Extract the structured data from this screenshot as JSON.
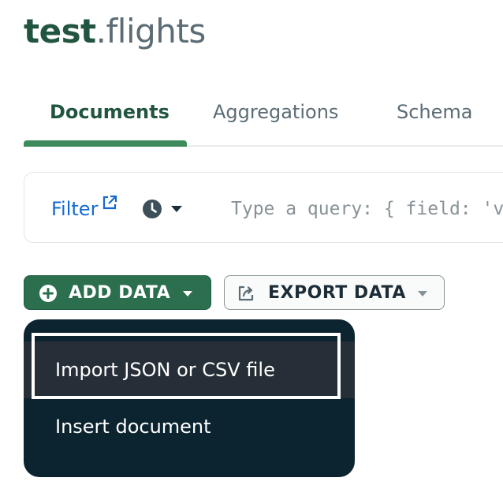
{
  "header": {
    "db": "test",
    "dot": ".",
    "collection": "flights"
  },
  "tabs": [
    {
      "label": "Documents",
      "active": true
    },
    {
      "label": "Aggregations",
      "active": false
    },
    {
      "label": "Schema",
      "active": false
    }
  ],
  "filter": {
    "label": "Filter",
    "placeholder": "Type a query: { field: 'value' }",
    "icons": [
      "external-link-icon",
      "clock-icon",
      "caret-down-icon"
    ]
  },
  "toolbar": {
    "add_data_label": "ADD DATA",
    "export_data_label": "EXPORT DATA"
  },
  "add_data_menu": {
    "items": [
      "Import JSON or CSV file",
      "Insert document"
    ],
    "highlighted_index": 0
  },
  "colors": {
    "brand_green": "#2b6f4e",
    "active_tab": "#21553f",
    "link_blue": "#136ad1",
    "menu_bg": "#0c2330"
  }
}
